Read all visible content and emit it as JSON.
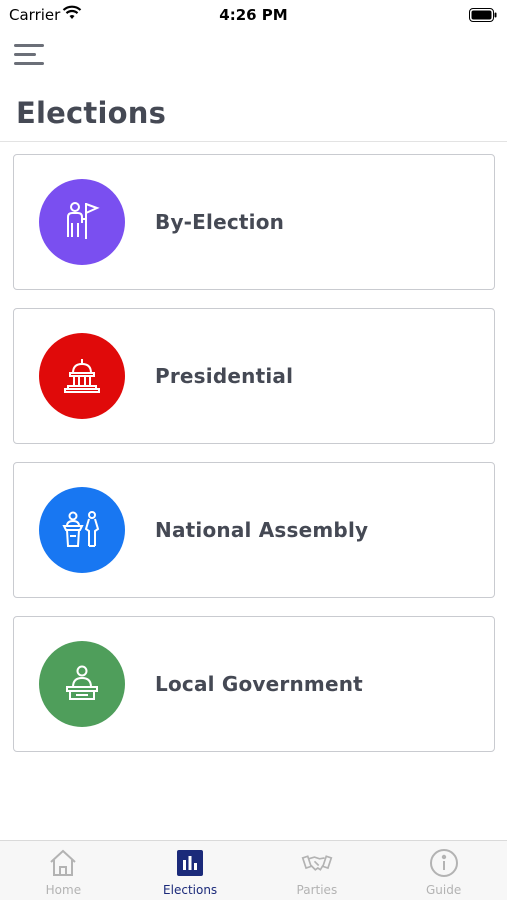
{
  "status_bar": {
    "carrier": "Carrier",
    "time": "4:26 PM"
  },
  "header": {
    "title": "Elections"
  },
  "elections": [
    {
      "label": "By-Election",
      "color": "#7a4ff0",
      "icon": "person-with-flag-icon"
    },
    {
      "label": "Presidential",
      "color": "#e00a0a",
      "icon": "capitol-building-icon"
    },
    {
      "label": "National Assembly",
      "color": "#1877f2",
      "icon": "podium-speaker-icon"
    },
    {
      "label": "Local Government",
      "color": "#4f9e5b",
      "icon": "official-at-desk-icon"
    }
  ],
  "tab_bar": {
    "tabs": [
      {
        "label": "Home",
        "icon": "home-icon",
        "active": false
      },
      {
        "label": "Elections",
        "icon": "bar-chart-icon",
        "active": true
      },
      {
        "label": "Parties",
        "icon": "handshake-icon",
        "active": false
      },
      {
        "label": "Guide",
        "icon": "info-icon",
        "active": false
      }
    ],
    "active_color": "#1b2a7a",
    "inactive_color": "#b3b3b3"
  }
}
